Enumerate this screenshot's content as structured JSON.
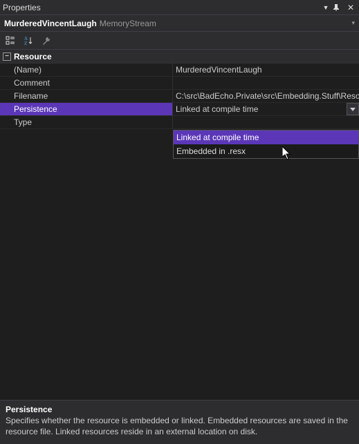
{
  "window": {
    "title": "Properties"
  },
  "object": {
    "name": "MurderedVincentLaugh",
    "type": "MemoryStream"
  },
  "category": {
    "label": "Resource"
  },
  "props": {
    "name_label": "(Name)",
    "name_value": "MurderedVincentLaugh",
    "comment_label": "Comment",
    "comment_value": "",
    "filename_label": "Filename",
    "filename_value": "C:\\src\\BadEcho.Private\\src\\Embedding.Stuff\\Reso",
    "persistence_label": "Persistence",
    "persistence_value": "Linked at compile time",
    "type_label": "Type",
    "type_value": ""
  },
  "dropdown": {
    "options": [
      "Linked at compile time",
      "Embedded in .resx"
    ]
  },
  "help": {
    "title": "Persistence",
    "description": "Specifies whether the resource is embedded or linked.  Embedded resources are saved in the resource file.  Linked resources reside in an external location on disk."
  }
}
